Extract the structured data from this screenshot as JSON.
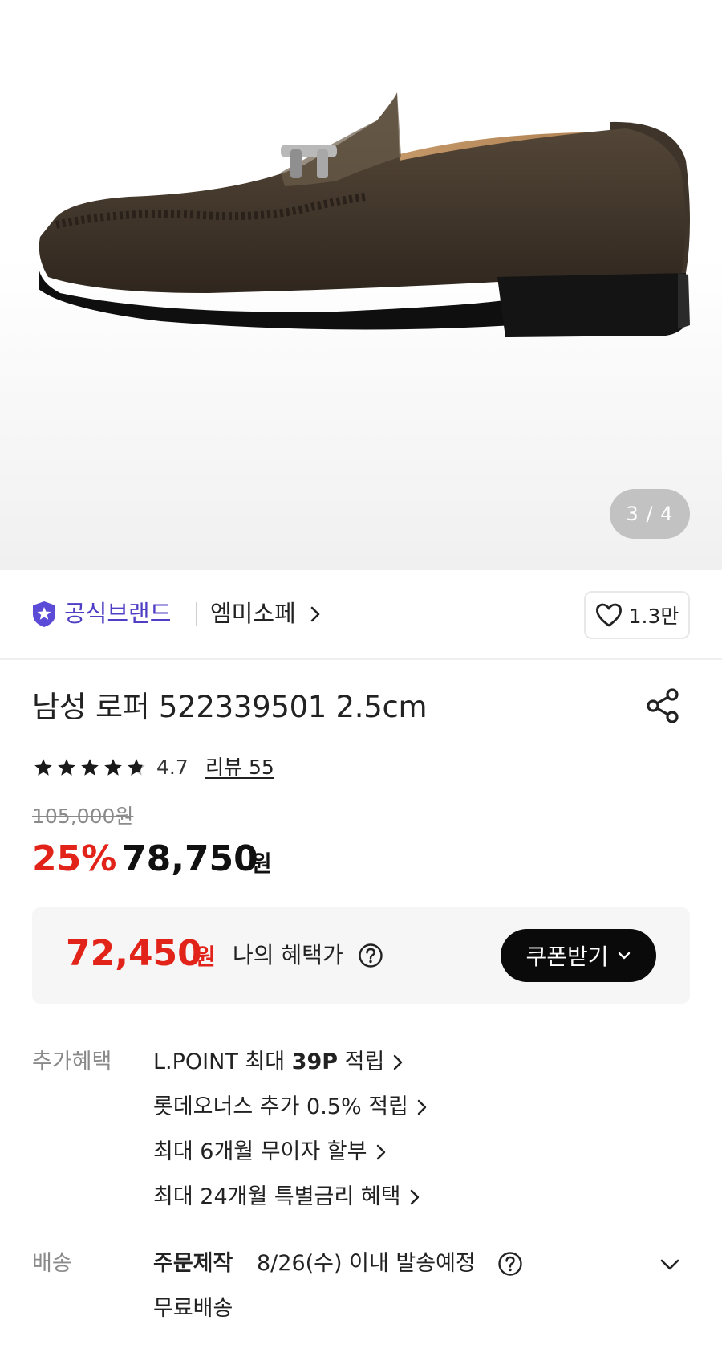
{
  "gallery": {
    "current": "3",
    "total": "4",
    "pager_text": "3 / 4"
  },
  "brand": {
    "official_label": "공식브랜드",
    "name": "엠미소페",
    "likes": "1.3만"
  },
  "product": {
    "title": "남성 로퍼 522339501 2.5cm",
    "rating": "4.7",
    "rating_value": 4.7,
    "review_label": "리뷰 55"
  },
  "price": {
    "original": "105,000원",
    "discount": "25%",
    "sale": "78,750",
    "currency": "원"
  },
  "my_benefit": {
    "price": "72,450",
    "currency": "원",
    "label": "나의 혜택가",
    "coupon_button": "쿠폰받기"
  },
  "extra_benefits": {
    "label": "추가혜택",
    "items": [
      {
        "prefix": "L.POINT 최대 ",
        "bold": "39P",
        "suffix": " 적립"
      },
      {
        "prefix": "롯데오너스 추가 0.5% 적립",
        "bold": "",
        "suffix": ""
      },
      {
        "prefix": "최대 6개월 무이자 할부",
        "bold": "",
        "suffix": ""
      },
      {
        "prefix": "최대 24개월 특별금리 혜택",
        "bold": "",
        "suffix": ""
      }
    ]
  },
  "shipping": {
    "label": "배송",
    "type": "주문제작",
    "date": "8/26(수) 이내 발송예정",
    "fee": "무료배송"
  },
  "colors": {
    "accent_red": "#e2231a",
    "brand_purple": "#4e3fc4",
    "button_black": "#0a0a0a"
  }
}
